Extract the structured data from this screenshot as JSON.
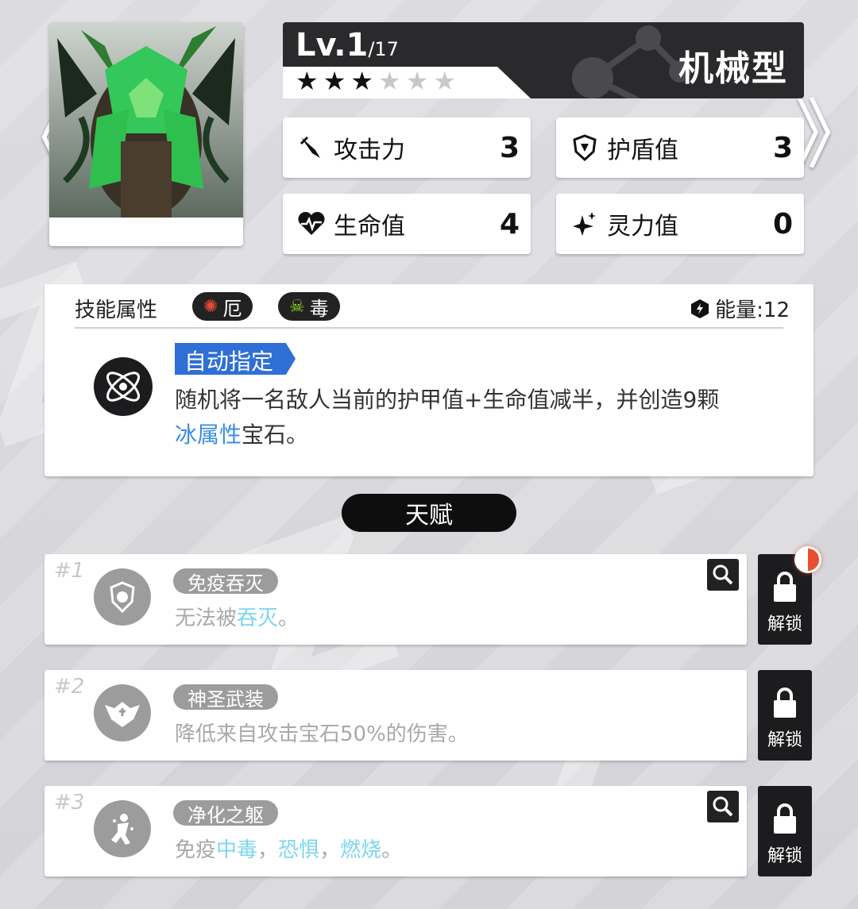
{
  "level": {
    "prefix": "Lv.1",
    "max": "/17",
    "stars_total": 6,
    "stars_filled": 3
  },
  "unit_type": "机械型",
  "stats": [
    {
      "icon": "sword-icon",
      "label": "攻击力",
      "value": "3"
    },
    {
      "icon": "shield-icon",
      "label": "护盾值",
      "value": "3"
    },
    {
      "icon": "heart-icon",
      "label": "生命值",
      "value": "4"
    },
    {
      "icon": "sparkle-icon",
      "label": "灵力值",
      "value": "0"
    }
  ],
  "skill": {
    "header": "技能属性",
    "elements": [
      {
        "label": "厄",
        "icon": "curse-icon",
        "color": "#e14a3a"
      },
      {
        "label": "毒",
        "icon": "poison-icon",
        "color": "#8fd82a"
      }
    ],
    "energy": "能量:12",
    "tag": "自动指定",
    "desc_part1": "随机将一名敌人当前的护甲值+生命值减半，并创造9颗",
    "desc_highlight": "冰属性",
    "desc_part2": "宝石。"
  },
  "talent_title": "天赋",
  "talents": [
    {
      "num": "#1",
      "name": "免疫吞灭",
      "desc_pre": "无法被",
      "desc_hl": [
        "吞灭"
      ],
      "desc_sep": [],
      "desc_post": "。",
      "has_magnify": true
    },
    {
      "num": "#2",
      "name": "神圣武装",
      "desc_pre": "降低来自攻击宝石50%的伤害。",
      "desc_hl": [],
      "desc_sep": [],
      "desc_post": "",
      "has_magnify": false
    },
    {
      "num": "#3",
      "name": "净化之躯",
      "desc_pre": "免疫",
      "desc_hl": [
        "中毒",
        "恐惧",
        "燃烧"
      ],
      "desc_sep": [
        "，",
        "，"
      ],
      "desc_post": "。",
      "has_magnify": true
    }
  ],
  "unlock_label": "解锁",
  "colors": {
    "accent_blue": "#2f6fd6",
    "highlight_cyan": "#7cd6ee",
    "dark": "#1c1c1e"
  }
}
